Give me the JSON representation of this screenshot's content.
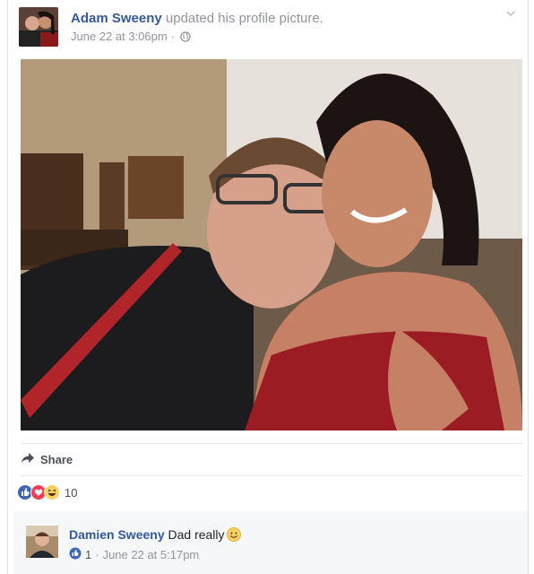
{
  "post": {
    "author_name": "Adam Sweeny",
    "action": "updated his profile picture.",
    "timestamp": "June 22 at 3:06pm",
    "separator": "·",
    "privacy_icon": "globe-icon",
    "menu_icon": "chevron-down-icon"
  },
  "actions": {
    "share_label": "Share",
    "share_icon": "share-arrow-icon"
  },
  "reactions": {
    "icons": [
      "like-icon",
      "love-icon",
      "haha-icon"
    ],
    "count": "10"
  },
  "comment": {
    "author_name": "Damien Sweeny",
    "text": "Dad really",
    "emoji": "smile-emoji-icon",
    "like_count": "1",
    "separator": "·",
    "timestamp": "June 22 at 5:17pm"
  },
  "colors": {
    "link": "#365899",
    "meta": "#90949c",
    "like_blue": "#4267b2",
    "love_red": "#f33e58",
    "haha_yellow": "#fcd060"
  }
}
